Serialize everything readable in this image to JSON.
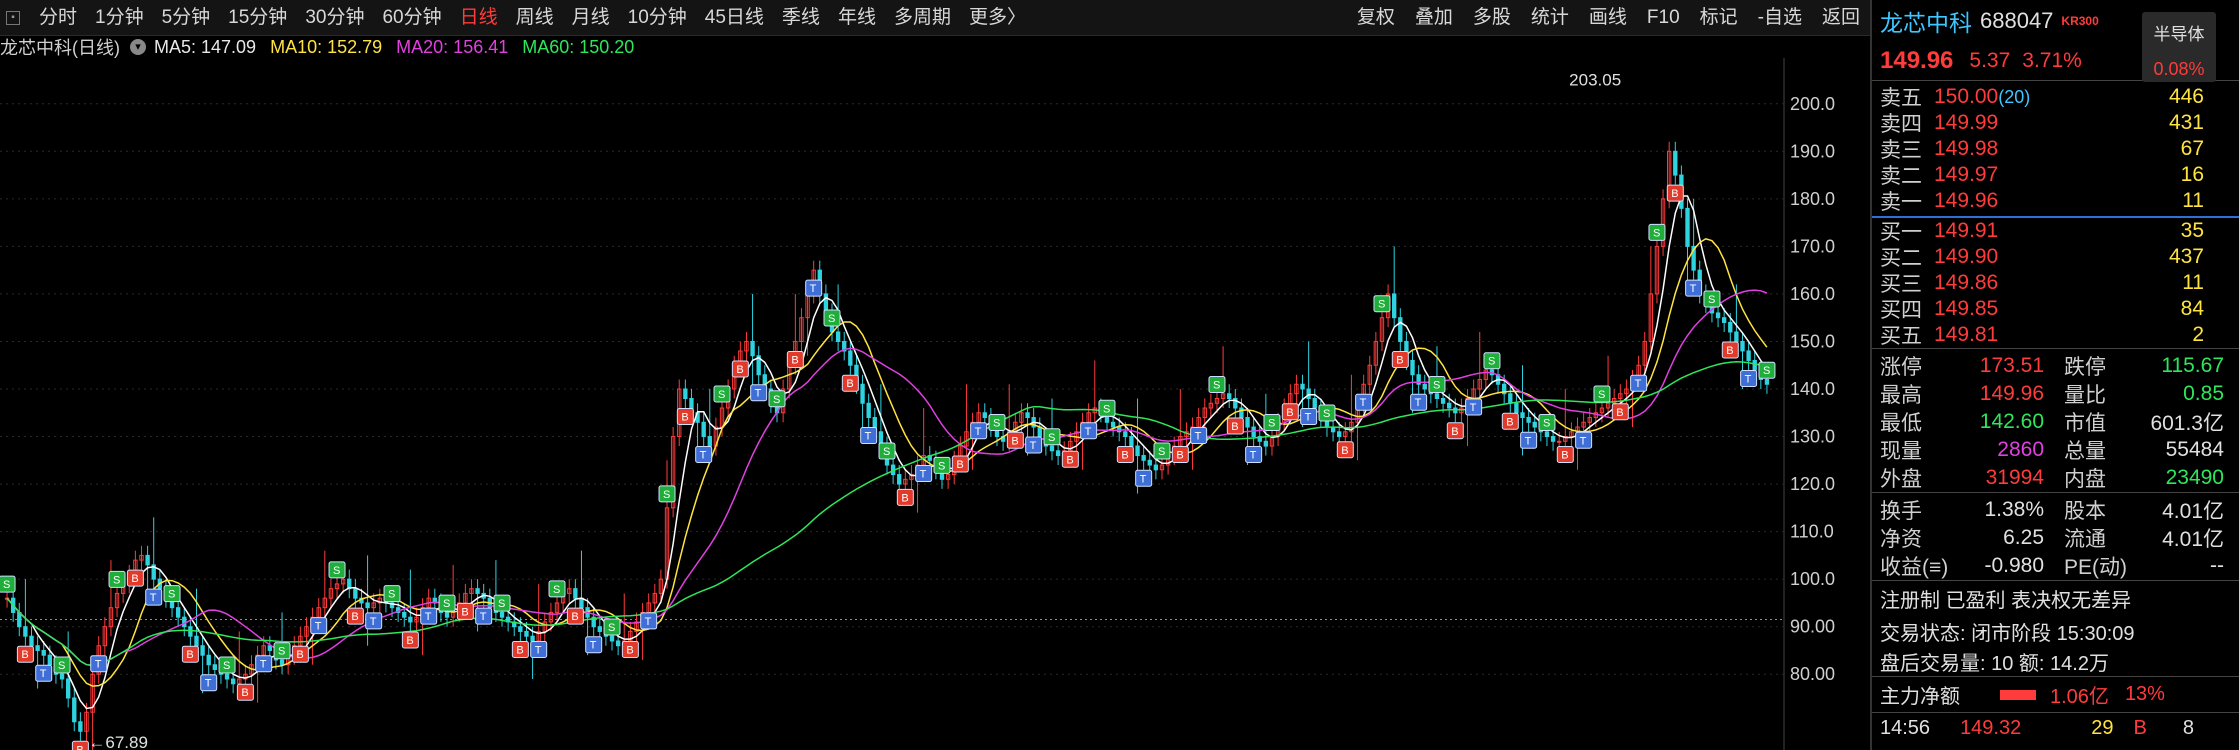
{
  "toolbar": {
    "periods": [
      "分时",
      "1分钟",
      "5分钟",
      "15分钟",
      "30分钟",
      "60分钟",
      "日线",
      "周线",
      "月线",
      "10分钟",
      "45日线",
      "季线",
      "年线",
      "多周期",
      "更多〉"
    ],
    "active_period": "日线",
    "tools": [
      "复权",
      "叠加",
      "多股",
      "统计",
      "画线",
      "F10",
      "标记",
      "-自选",
      "返回"
    ]
  },
  "ma_legend": {
    "title": "龙芯中科(日线)",
    "ma5": "MA5: 147.09",
    "ma10": "MA10: 152.79",
    "ma20": "MA20: 156.41",
    "ma60": "MA60: 150.20"
  },
  "chart_data": {
    "type": "candlestick",
    "ylim": [
      75,
      205
    ],
    "y_ticks": [
      "200.0",
      "190.0",
      "180.0",
      "170.0",
      "160.0",
      "150.0",
      "140.0",
      "130.0",
      "120.0",
      "110.0",
      "100.0",
      "90.00",
      "80.00"
    ],
    "annotations": {
      "high": "203.05",
      "low": "67.89"
    },
    "series": [
      {
        "name": "MA5",
        "color": "#ffffff"
      },
      {
        "name": "MA10",
        "color": "#ffe440"
      },
      {
        "name": "MA20",
        "color": "#e040e0"
      },
      {
        "name": "MA60",
        "color": "#2ee65a"
      }
    ],
    "close": [
      96,
      93,
      90,
      88,
      86,
      85,
      84,
      82,
      80,
      79,
      75,
      70,
      68,
      72,
      80,
      86,
      90,
      94,
      97,
      99,
      101,
      104,
      105,
      103,
      100,
      98,
      96,
      94,
      92,
      90,
      88,
      86,
      84,
      82,
      81,
      80,
      79,
      78,
      79,
      80,
      82,
      84,
      86,
      85,
      83,
      82,
      84,
      86,
      88,
      90,
      92,
      94,
      96,
      98,
      99,
      100,
      98,
      96,
      95,
      94,
      95,
      96,
      95,
      94,
      93,
      92,
      91,
      92,
      94,
      96,
      95,
      93,
      92,
      93,
      95,
      97,
      98,
      97,
      96,
      94,
      93,
      92,
      91,
      90,
      89,
      88,
      87,
      89,
      91,
      93,
      95,
      97,
      98,
      96,
      94,
      92,
      90,
      89,
      88,
      87,
      86,
      87,
      89,
      91,
      93,
      95,
      97,
      100,
      115,
      130,
      140,
      138,
      135,
      133,
      130,
      128,
      132,
      136,
      140,
      145,
      148,
      150,
      147,
      143,
      140,
      137,
      135,
      140,
      145,
      150,
      155,
      160,
      165,
      160,
      156,
      152,
      150,
      148,
      145,
      141,
      137,
      134,
      131,
      128,
      124,
      122,
      120,
      121,
      122,
      124,
      126,
      125,
      123,
      121,
      122,
      125,
      128,
      131,
      133,
      135,
      134,
      132,
      130,
      129,
      131,
      133,
      135,
      134,
      132,
      130,
      128,
      127,
      126,
      127,
      129,
      131,
      133,
      135,
      136,
      135,
      133,
      132,
      131,
      130,
      128,
      126,
      125,
      124,
      123,
      124,
      126,
      128,
      130,
      131,
      132,
      134,
      136,
      137,
      138,
      139,
      138,
      136,
      134,
      132,
      130,
      129,
      128,
      130,
      133,
      136,
      139,
      141,
      140,
      138,
      136,
      134,
      132,
      131,
      130,
      131,
      133,
      137,
      141,
      145,
      150,
      155,
      160,
      155,
      150,
      146,
      143,
      141,
      140,
      139,
      138,
      137,
      136,
      135,
      136,
      138,
      140,
      142,
      144,
      143,
      141,
      139,
      137,
      135,
      134,
      133,
      132,
      131,
      130,
      129,
      129,
      130,
      131,
      132,
      133,
      134,
      135,
      136,
      137,
      138,
      139,
      140,
      142,
      145,
      150,
      160,
      170,
      180,
      190,
      185,
      178,
      170,
      165,
      160,
      158,
      156,
      155,
      154,
      152,
      150,
      148,
      146,
      144,
      142,
      141
    ]
  },
  "panel": {
    "name": "龙芯中科",
    "code": "688047",
    "tag": "KR300",
    "sector_label": "半导体",
    "sector_pct": "0.08%",
    "price": "149.96",
    "change": "5.37",
    "change_pct": "3.71%",
    "asks": [
      {
        "label": "卖五",
        "price": "150.00",
        "count": "(20)",
        "vol": "446"
      },
      {
        "label": "卖四",
        "price": "149.99",
        "count": "",
        "vol": "431"
      },
      {
        "label": "卖三",
        "price": "149.98",
        "count": "",
        "vol": "67"
      },
      {
        "label": "卖二",
        "price": "149.97",
        "count": "",
        "vol": "16"
      },
      {
        "label": "卖一",
        "price": "149.96",
        "count": "",
        "vol": "11"
      }
    ],
    "bids": [
      {
        "label": "买一",
        "price": "149.91",
        "count": "",
        "vol": "35"
      },
      {
        "label": "买二",
        "price": "149.90",
        "count": "",
        "vol": "437"
      },
      {
        "label": "买三",
        "price": "149.86",
        "count": "",
        "vol": "11"
      },
      {
        "label": "买四",
        "price": "149.85",
        "count": "",
        "vol": "84"
      },
      {
        "label": "买五",
        "price": "149.81",
        "count": "",
        "vol": "2"
      }
    ],
    "stats1": [
      {
        "k": "涨停",
        "v": "173.51",
        "vc": "red",
        "k2": "跌停",
        "v2": "115.67",
        "v2c": "green"
      },
      {
        "k": "最高",
        "v": "149.96",
        "vc": "red",
        "k2": "量比",
        "v2": "0.85",
        "v2c": "green"
      },
      {
        "k": "最低",
        "v": "142.60",
        "vc": "green",
        "k2": "市值",
        "v2": "601.3亿",
        "v2c": "white"
      },
      {
        "k": "现量",
        "v": "2860",
        "vc": "magenta",
        "k2": "总量",
        "v2": "55484",
        "v2c": "white"
      },
      {
        "k": "外盘",
        "v": "31994",
        "vc": "red",
        "k2": "内盘",
        "v2": "23490",
        "v2c": "green"
      }
    ],
    "stats2": [
      {
        "k": "换手",
        "v": "1.38%",
        "k2": "股本",
        "v2": "4.01亿"
      },
      {
        "k": "净资",
        "v": "6.25",
        "k2": "流通",
        "v2": "4.01亿"
      },
      {
        "k": "收益(≡)",
        "v": "-0.980",
        "k2": "PE(动)",
        "v2": "--"
      }
    ],
    "tagline": "注册制 已盈利 表决权无差异",
    "trade_status": "交易状态: 闭市阶段 15:30:09",
    "after_hours": "盘后交易量: 10  额: 14.2万",
    "flow_label": "主力净额",
    "flow_value": "1.06亿",
    "flow_pct": "13%",
    "tick_time": "14:56",
    "tick_price": "149.32",
    "tick_vol": "29",
    "tick_side": "B",
    "tick_n": "8"
  }
}
